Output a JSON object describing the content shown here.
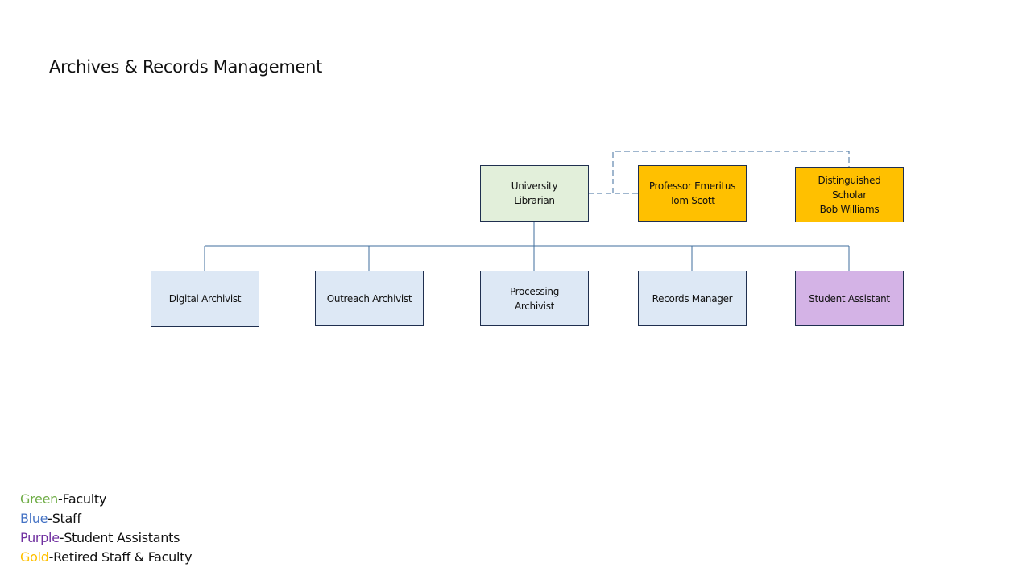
{
  "title": "Archives & Records Management",
  "colors": {
    "faculty": "#e2efda",
    "staff": "#dde8f5",
    "student": "#d4b3e6",
    "retired": "#ffc000",
    "connector": "#3f6e9c"
  },
  "nodes": {
    "university_librarian": "University\nLibrarian",
    "professor_emeritus": "Professor Emeritus\nTom Scott",
    "distinguished_scholar": "Distinguished\nScholar\nBob Williams",
    "digital_archivist": "Digital Archivist",
    "outreach_archivist": "Outreach Archivist",
    "processing_archivist": "Processing\nArchivist",
    "records_manager": "Records Manager",
    "student_assistant": "Student Assistant"
  },
  "legend": [
    {
      "color_name": "Green",
      "color": "#70ad47",
      "meaning": "-Faculty"
    },
    {
      "color_name": "Blue",
      "color": "#4472c4",
      "meaning": "-Staff"
    },
    {
      "color_name": "Purple",
      "color": "#7030a0",
      "meaning": "-Student Assistants"
    },
    {
      "color_name": "Gold",
      "color": "#ffc000",
      "meaning": "-Retired Staff & Faculty"
    }
  ]
}
